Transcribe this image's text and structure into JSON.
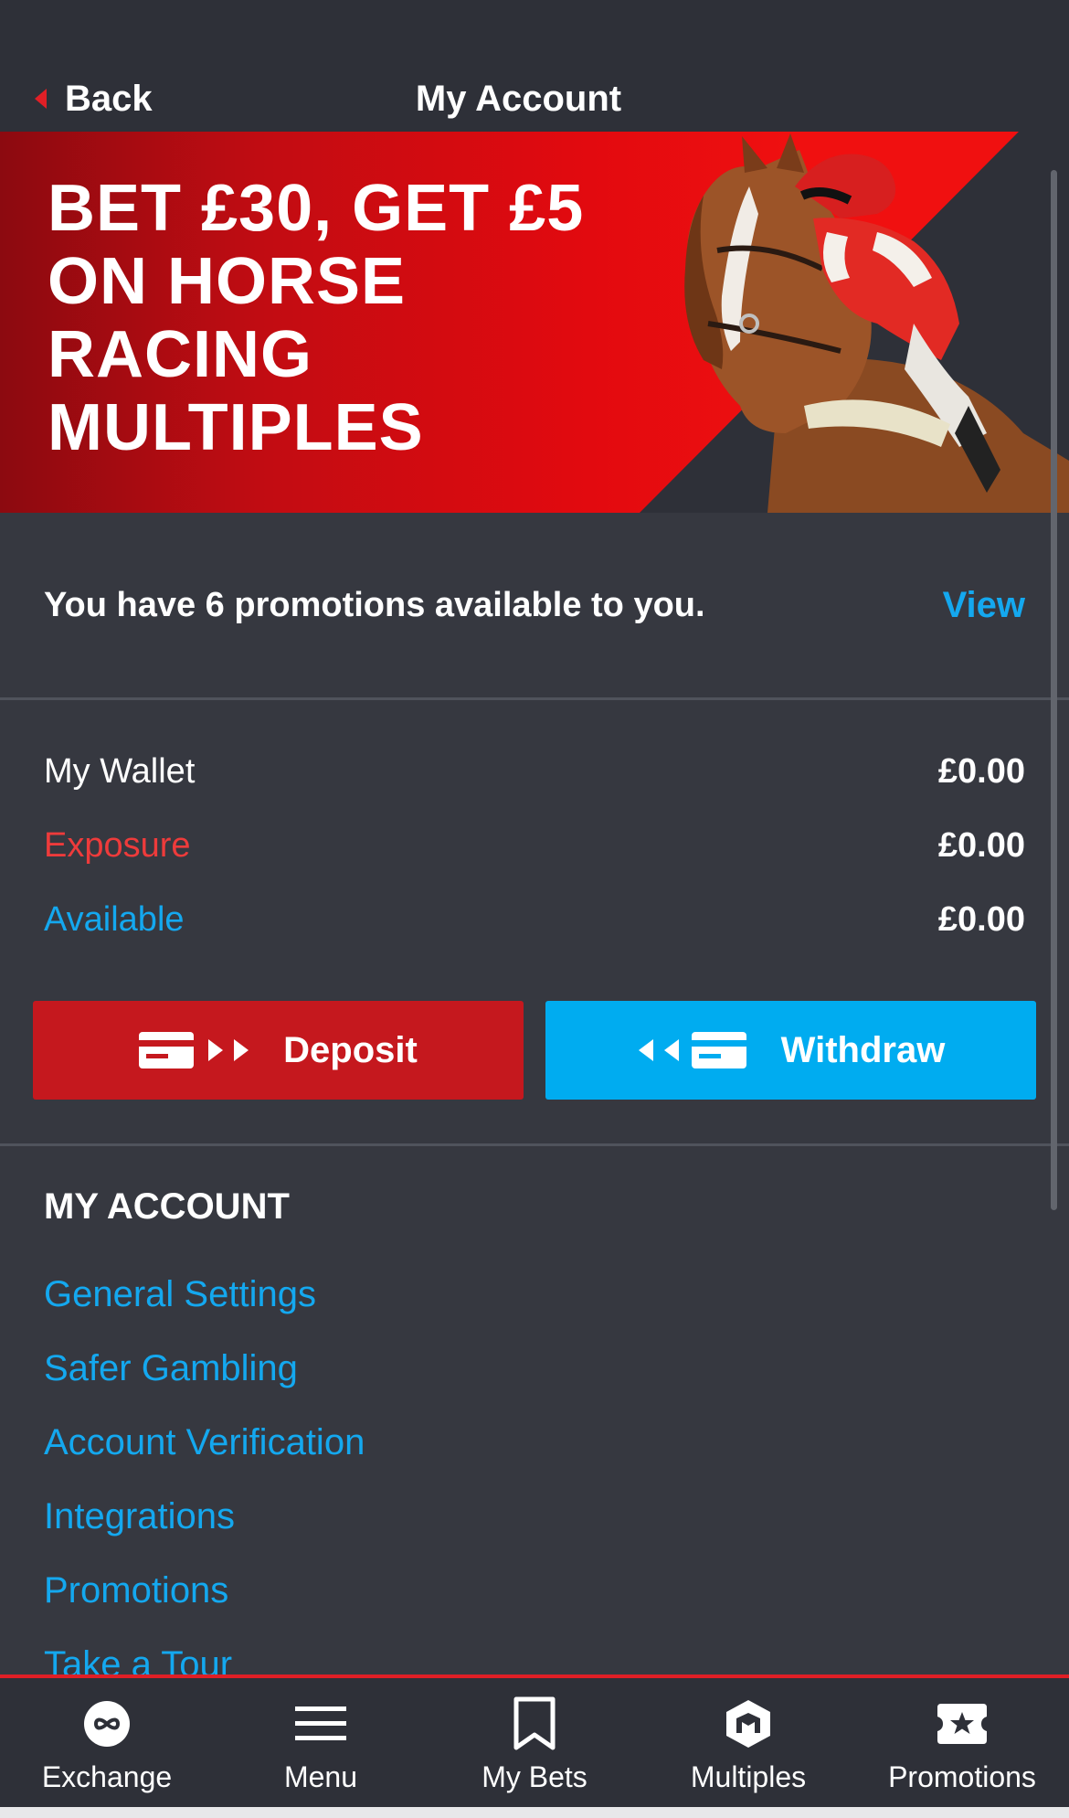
{
  "header": {
    "back_label": "Back",
    "title": "My Account"
  },
  "banner": {
    "headline": "BET £30, GET £5 ON HORSE RACING MULTIPLES"
  },
  "promotions_bar": {
    "message": "You have 6 promotions available to you.",
    "action_label": "View"
  },
  "wallet": {
    "rows": [
      {
        "label": "My Wallet",
        "value": "£0.00",
        "label_color": "#ffffff"
      },
      {
        "label": "Exposure",
        "value": "£0.00",
        "label_color": "#ee3b3b"
      },
      {
        "label": "Available",
        "value": "£0.00",
        "label_color": "#14a8ef"
      }
    ]
  },
  "actions": {
    "deposit_label": "Deposit",
    "withdraw_label": "Withdraw"
  },
  "account_menu": {
    "title": "MY ACCOUNT",
    "items": [
      {
        "label": "General Settings"
      },
      {
        "label": "Safer Gambling"
      },
      {
        "label": "Account Verification"
      },
      {
        "label": "Integrations"
      },
      {
        "label": "Promotions"
      },
      {
        "label": "Take a Tour"
      }
    ]
  },
  "bottom_nav": {
    "items": [
      {
        "label": "Exchange",
        "icon": "exchange-icon"
      },
      {
        "label": "Menu",
        "icon": "hamburger-menu-icon"
      },
      {
        "label": "My Bets",
        "icon": "bookmark-icon"
      },
      {
        "label": "Multiples",
        "icon": "multiples-icon"
      },
      {
        "label": "Promotions",
        "icon": "star-ticket-icon"
      }
    ]
  },
  "colors": {
    "accent_red": "#e01f26",
    "deposit_red": "#c5181e",
    "accent_blue": "#14a8ef",
    "withdraw_blue": "#00acf0",
    "background": "#363840"
  }
}
